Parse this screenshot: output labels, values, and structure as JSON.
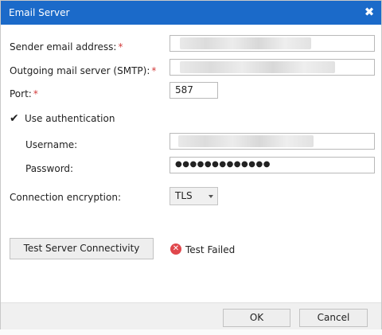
{
  "dialog": {
    "title": "Email Server",
    "close_glyph": "✖"
  },
  "form": {
    "sender_label": "Sender email address:",
    "smtp_label": "Outgoing mail server (SMTP):",
    "port_label": "Port:",
    "port_value": "587",
    "required_mark": "*",
    "use_auth_label": "Use authentication",
    "use_auth_checked": true,
    "check_glyph": "✔",
    "username_label": "Username:",
    "password_label": "Password:",
    "password_value": "●●●●●●●●●●●●●",
    "encryption_label": "Connection encryption:",
    "encryption_value": "TLS"
  },
  "test": {
    "button_label": "Test Server Connectivity",
    "status_text": "Test Failed",
    "status_glyph": "✕",
    "status_color": "#e0474c"
  },
  "footer": {
    "ok_label": "OK",
    "cancel_label": "Cancel"
  },
  "colors": {
    "titlebar": "#1b6ac9",
    "required": "#d23b3b"
  }
}
